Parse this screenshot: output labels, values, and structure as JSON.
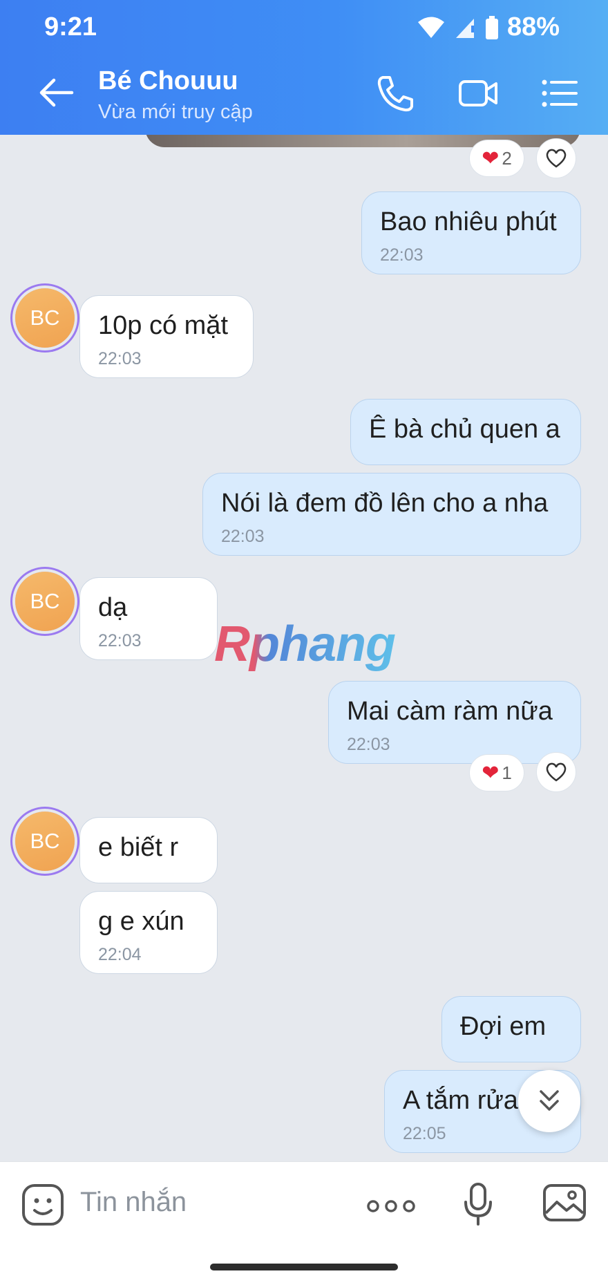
{
  "status_bar": {
    "time": "9:21",
    "battery_percent": "88%"
  },
  "header": {
    "contact_name": "Bé Chouuu",
    "status": "Vừa mới truy cập"
  },
  "avatar_initials": "BC",
  "messages": [
    {
      "side": "out",
      "text": "Bao nhiêu phút",
      "time": "22:03"
    },
    {
      "side": "in",
      "text": "10p có mặt",
      "time": "22:03"
    },
    {
      "side": "out",
      "text": "Ê bà chủ quen a"
    },
    {
      "side": "out",
      "text": "Nói là đem đồ lên cho a nha",
      "time": "22:03"
    },
    {
      "side": "in",
      "text": "dạ",
      "time": "22:03"
    },
    {
      "side": "out",
      "text": "Mai càm ràm nữa",
      "time": "22:03"
    },
    {
      "side": "in",
      "text": "e biết r"
    },
    {
      "side": "in",
      "text": "g e xún",
      "time": "22:04"
    },
    {
      "side": "out",
      "text": "Đợi em"
    },
    {
      "side": "out",
      "text": "A tắm rửa",
      "time": "22:05"
    }
  ],
  "reactions": [
    {
      "count": "2"
    },
    {
      "count": "1"
    }
  ],
  "watermark": "Rphang",
  "composer": {
    "placeholder": "Tin nhắn"
  },
  "colors": {
    "header": "#3f8ef5",
    "outgoing_bubble": "#d9ebfd",
    "incoming_bubble": "#ffffff",
    "background": "#e6e9ee"
  }
}
